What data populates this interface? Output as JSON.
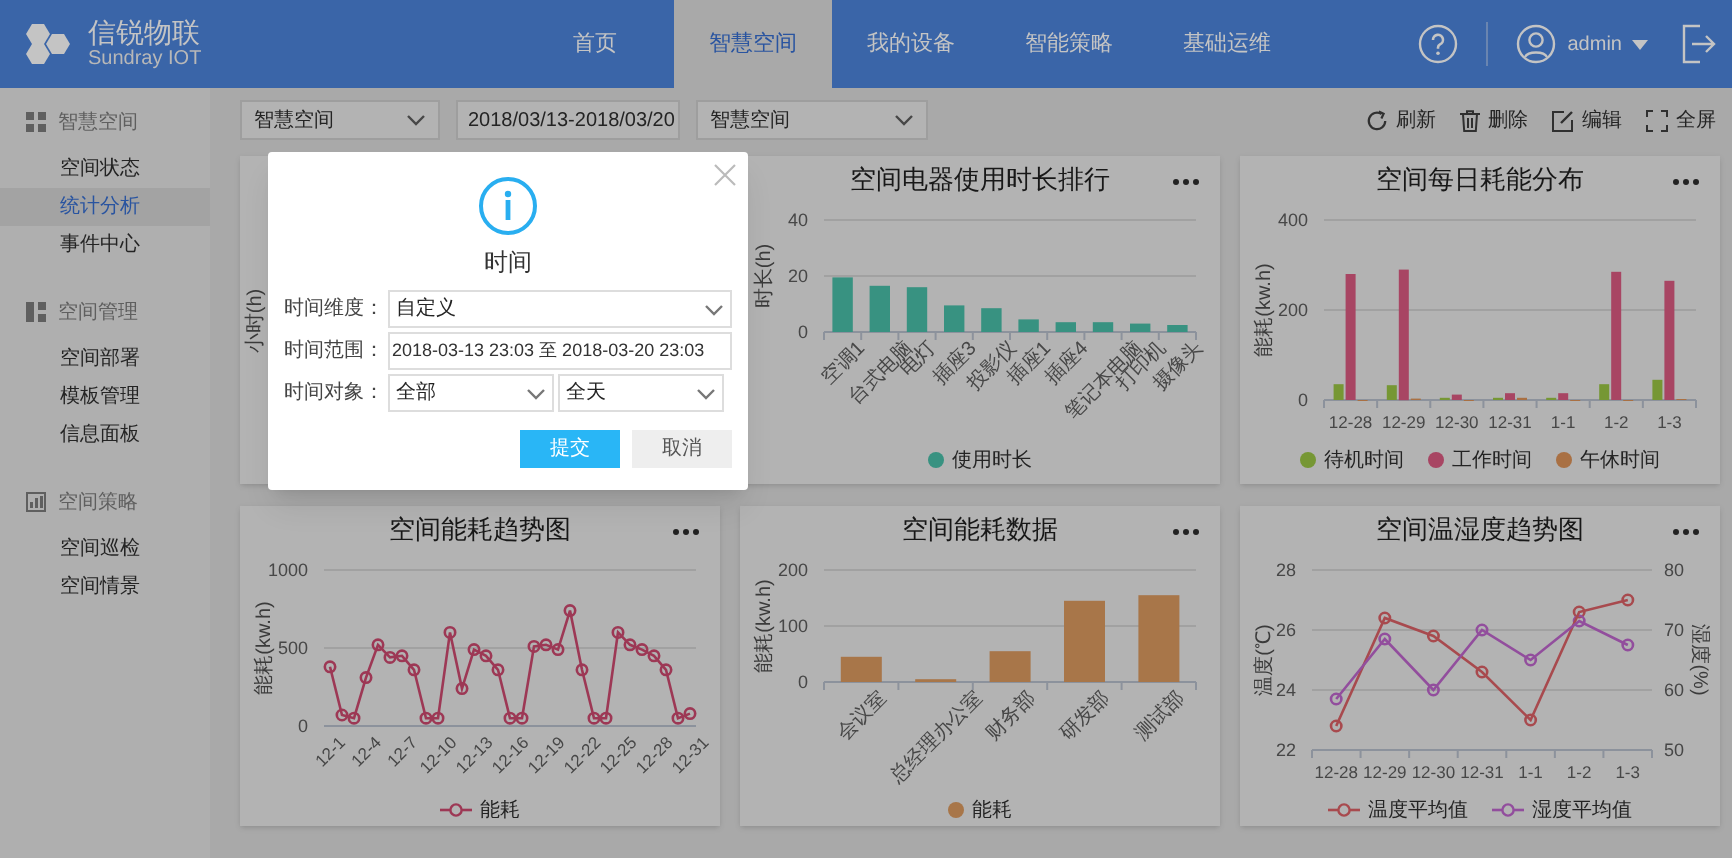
{
  "header": {
    "logo_title": "信锐物联",
    "logo_subtitle": "Sundray IOT",
    "nav": [
      {
        "label": "首页",
        "selected": false
      },
      {
        "label": "智慧空间",
        "selected": true
      },
      {
        "label": "我的设备",
        "selected": false
      },
      {
        "label": "智能策略",
        "selected": false
      },
      {
        "label": "基础运维",
        "selected": false
      }
    ],
    "user": "admin"
  },
  "sidebar": {
    "groups": [
      {
        "title": "智慧空间",
        "items": [
          {
            "label": "空间状态",
            "selected": false
          },
          {
            "label": "统计分析",
            "selected": true
          },
          {
            "label": "事件中心",
            "selected": false
          }
        ]
      },
      {
        "title": "空间管理",
        "items": [
          {
            "label": "空间部署",
            "selected": false
          },
          {
            "label": "模板管理",
            "selected": false
          },
          {
            "label": "信息面板",
            "selected": false
          }
        ]
      },
      {
        "title": "空间策略",
        "items": [
          {
            "label": "空间巡检",
            "selected": false
          },
          {
            "label": "空间情景",
            "selected": false
          }
        ]
      }
    ]
  },
  "toolbar": {
    "filters": [
      {
        "kind": "select",
        "value": "智慧空间"
      },
      {
        "kind": "text",
        "value": "2018/03/13-2018/03/20"
      },
      {
        "kind": "select",
        "value": "智慧空间"
      }
    ],
    "actions": [
      {
        "label": "刷新"
      },
      {
        "label": "删除"
      },
      {
        "label": "编辑"
      },
      {
        "label": "全屏"
      }
    ]
  },
  "cards": [
    {
      "kind": "covered",
      "ylabel": "小时(h)"
    },
    {
      "kind": "chart",
      "chart_data": {
        "type": "bar",
        "title": "空间电器使用时长排行",
        "ylabel": "时长(h)",
        "ylim": [
          0,
          40
        ],
        "yticks": [
          0,
          20,
          40
        ],
        "categories": [
          "空调1",
          "台式电脑",
          "电灯",
          "插座3",
          "投影仪",
          "插座1",
          "插座4",
          "笔记本电脑",
          "打印机",
          "摄像头"
        ],
        "series": [
          {
            "name": "使用时长",
            "color": "#389281",
            "values": [
              19.5,
              16.5,
              16,
              9.5,
              8.5,
              4.5,
              3.5,
              3.5,
              3,
              2.5
            ]
          }
        ]
      }
    },
    {
      "kind": "chart",
      "chart_data": {
        "type": "bar",
        "title": "空间每日耗能分布",
        "ylabel": "能耗(kw.h)",
        "ylim": [
          0,
          400
        ],
        "yticks": [
          0,
          200,
          400
        ],
        "categories": [
          "12-28",
          "12-29",
          "12-30",
          "12-31",
          "1-1",
          "1-2",
          "1-3"
        ],
        "series": [
          {
            "name": "待机时间",
            "color": "#769734",
            "values": [
              35,
              33,
              5,
              5,
              5,
              35,
              45
            ]
          },
          {
            "name": "工作时间",
            "color": "#a84563",
            "values": [
              280,
              290,
              12,
              15,
              15,
              285,
              265
            ]
          },
          {
            "name": "午休时间",
            "color": "#a97043",
            "values": [
              0,
              3,
              0,
              5,
              0,
              0,
              2
            ]
          }
        ]
      }
    },
    {
      "kind": "chart",
      "chart_data": {
        "type": "line",
        "title": "空间能耗趋势图",
        "ylabel": "能耗(kw.h)",
        "ylim": [
          0,
          1000
        ],
        "yticks": [
          0,
          500,
          1000
        ],
        "categories": [
          "12-1",
          null,
          null,
          "12-4",
          null,
          null,
          "12-7",
          null,
          null,
          "12-10",
          null,
          null,
          "12-13",
          null,
          null,
          "12-16",
          null,
          null,
          "12-19",
          null,
          null,
          "12-22",
          null,
          null,
          "12-25",
          null,
          null,
          "12-28",
          null,
          null,
          "12-31"
        ],
        "series": [
          {
            "name": "能耗",
            "color": "#9d3855",
            "marker": "circle",
            "values": [
              380,
              70,
              50,
              310,
              520,
              440,
              450,
              360,
              50,
              50,
              600,
              240,
              490,
              450,
              360,
              50,
              50,
              510,
              520,
              490,
              740,
              360,
              50,
              50,
              600,
              520,
              490,
              450,
              360,
              50,
              80
            ]
          }
        ]
      }
    },
    {
      "kind": "chart",
      "chart_data": {
        "type": "bar",
        "title": "空间能耗数据",
        "ylabel": "能耗(kw.h)",
        "ylim": [
          0,
          200
        ],
        "yticks": [
          0,
          100,
          200
        ],
        "categories": [
          "会议室",
          "总经理办公室",
          "财务部",
          "研发部",
          "测试部"
        ],
        "series": [
          {
            "name": "能耗",
            "color": "#a87649",
            "values": [
              45,
              5,
              55,
              145,
              155
            ]
          }
        ]
      }
    },
    {
      "kind": "chart",
      "chart_data": {
        "type": "line",
        "title": "空间温湿度趋势图",
        "ylabel": "温度(℃)",
        "ylim": [
          22,
          28
        ],
        "yticks": [
          22,
          24,
          26,
          28
        ],
        "y2label": "湿度(%)",
        "y2lim": [
          50,
          80
        ],
        "y2ticks": [
          50,
          60,
          70,
          80
        ],
        "categories": [
          "12-28",
          "12-29",
          "12-30",
          "12-31",
          "1-1",
          "1-2",
          "1-3"
        ],
        "series": [
          {
            "name": "温度平均值",
            "color": "#a84a4e",
            "marker": "circle",
            "values": [
              22.8,
              26.4,
              25.8,
              24.6,
              23,
              26.6,
              27
            ]
          },
          {
            "name": "湿度平均值",
            "color": "#924e9d",
            "marker": "circle",
            "axis": "y2",
            "values": [
              58.5,
              68.5,
              60,
              70,
              65,
              71.5,
              67.5
            ]
          }
        ]
      }
    }
  ],
  "modal": {
    "title": "时间",
    "fields": [
      {
        "label": "时间维度：",
        "controls": [
          {
            "kind": "select",
            "value": "自定义"
          }
        ]
      },
      {
        "label": "时间范围：",
        "controls": [
          {
            "kind": "input",
            "value": "2018-03-13 23:03 至 2018-03-20 23:03"
          }
        ]
      },
      {
        "label": "时间对象：",
        "controls": [
          {
            "kind": "select",
            "value": "全部"
          },
          {
            "kind": "select",
            "value": "全天"
          }
        ]
      }
    ],
    "buttons": [
      {
        "kind": "primary",
        "label": "提交"
      },
      {
        "kind": "secondary",
        "label": "取消"
      }
    ]
  }
}
